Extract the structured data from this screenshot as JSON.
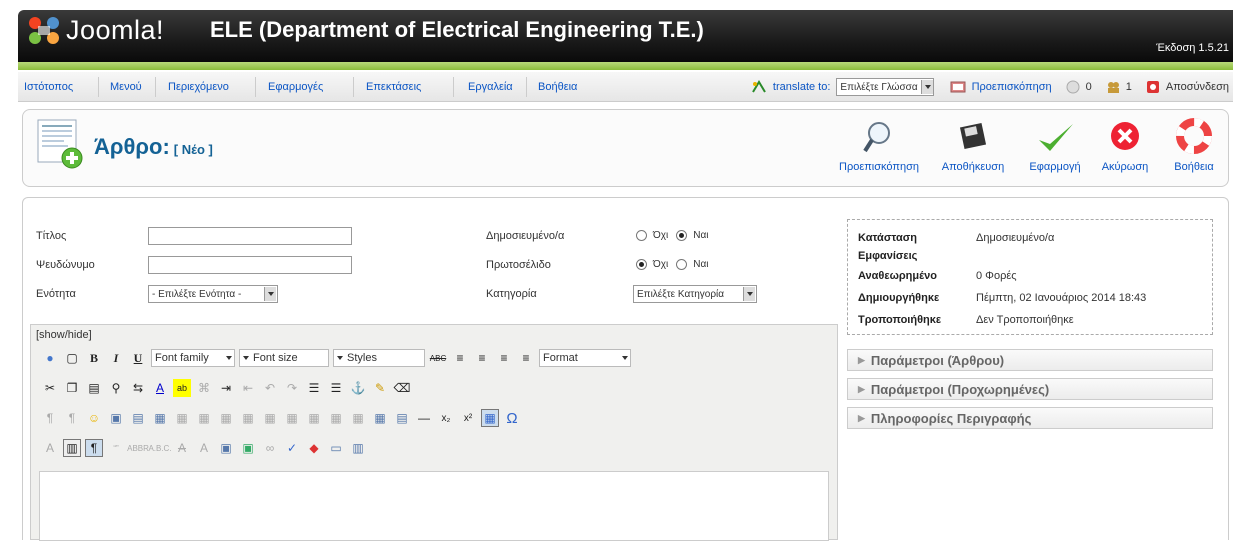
{
  "header": {
    "logo_word": "Joomla!",
    "site_title": "ELE (Department of Electrical Engineering T.E.)",
    "version": "Έκδοση 1.5.21"
  },
  "menu": {
    "items": [
      "Ιστότοπος",
      "Μενού",
      "Περιεχόμενο",
      "Εφαρμογές",
      "Επεκτάσεις",
      "Εργαλεία",
      "Βοήθεια"
    ],
    "translate_label": "translate to:",
    "language_select": "Επιλέξτε Γλώσσα",
    "preview_link": "Προεπισκόπηση",
    "messages_count": "0",
    "users_count": "1",
    "logout": "Αποσύνδεση"
  },
  "toolbar": {
    "title": "Άρθρο:",
    "title_tag": "[ Νέο ]",
    "preview": "Προεπισκόπηση",
    "save": "Αποθήκευση",
    "apply": "Εφαρμογή",
    "cancel": "Ακύρωση",
    "help": "Βοήθεια"
  },
  "form": {
    "title_label": "Τίτλος",
    "title_value": "",
    "alias_label": "Ψευδώνυμο",
    "alias_value": "",
    "section_label": "Ενότητα",
    "section_value": "- Επιλέξτε Ενότητα -",
    "published_label": "Δημοσιευμένο/α",
    "frontpage_label": "Πρωτοσέλιδο",
    "category_label": "Κατηγορία",
    "category_value": "Επιλέξτε Κατηγορία",
    "no_label": "Όχι",
    "yes_label": "Ναι",
    "published_selected": "yes",
    "frontpage_selected": "no"
  },
  "status": {
    "state_key": "Κατάσταση",
    "state_val": "Δημοσιευμένο/α",
    "hits_key": "Εμφανίσεις",
    "hits_val": "",
    "revised_key": "Αναθεωρημένο",
    "revised_val": "0 Φορές",
    "created_key": "Δημιουργήθηκε",
    "created_val": "Πέμπτη, 02 Ιανουάριος 2014 18:43",
    "modified_key": "Τροποποιήθηκε",
    "modified_val": "Δεν Τροποποιήθηκε"
  },
  "panels": [
    "Παράμετροι (Άρθρου)",
    "Παράμετροι (Προχωρημένες)",
    "Πληροφορίες Περιγραφής"
  ],
  "editor": {
    "showhide": "[show/hide]",
    "font_family": "Font family",
    "font_size": "Font size",
    "styles": "Styles",
    "format": "Format"
  }
}
